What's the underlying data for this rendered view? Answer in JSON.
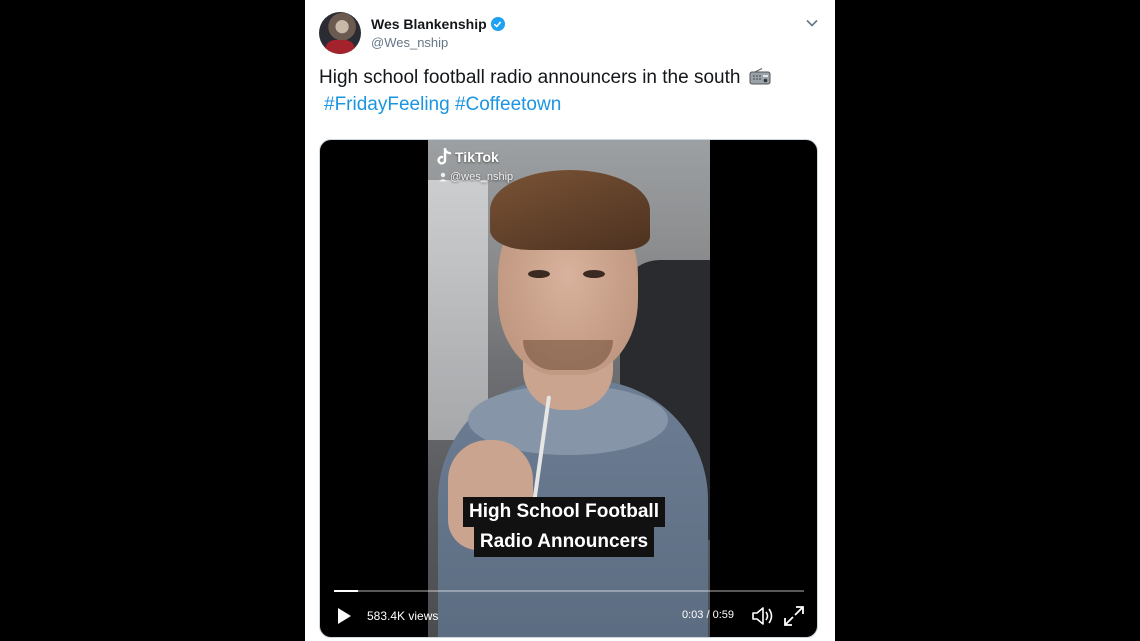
{
  "tweet": {
    "author_name": "Wes Blankenship",
    "author_handle": "@Wes_nship",
    "text_line1": "High school football radio announcers in the south",
    "hashtags": [
      "#FridayFeeling",
      "#Coffeetown"
    ],
    "icons": {
      "verified": "verified-badge-icon",
      "menu": "chevron-down-icon",
      "emoji": "radio-emoji-icon"
    }
  },
  "video": {
    "overlay_brand": "TikTok",
    "overlay_handle": "@wes_nship",
    "caption_line1": "High School Football",
    "caption_line2": "Radio Announcers",
    "views": "583.4K views",
    "time": "0:03 / 0:59",
    "progress_fraction": 0.05,
    "icons": {
      "play": "play-icon",
      "volume": "volume-icon",
      "fullscreen": "fullscreen-icon"
    }
  },
  "colors": {
    "hashtag": "#1b95e0",
    "verified": "#1da1f2",
    "name": "#14171a",
    "handle": "#657786",
    "page_bg": "#000000"
  }
}
